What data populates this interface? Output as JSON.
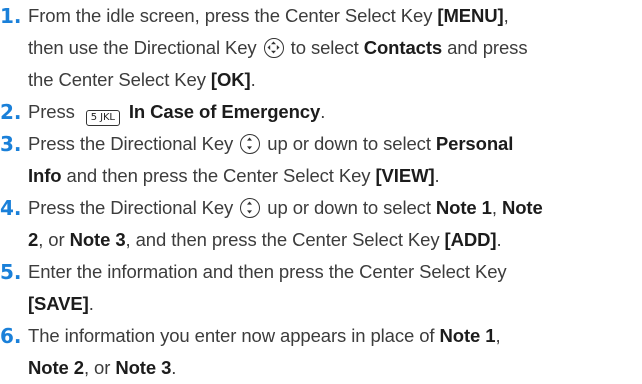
{
  "steps": [
    {
      "num": "1.",
      "l1a": "From the idle screen, press the Center Select Key ",
      "l1b": "[MENU]",
      "l1c": ",",
      "l2a": "then use the Directional Key ",
      "l2b": " to select ",
      "l2c": "Contacts",
      "l2d": " and press",
      "l3a": "the Center Select Key ",
      "l3b": "[OK]",
      "l3c": "."
    },
    {
      "num": "2.",
      "l1a": "Press ",
      "key": "5 JKL",
      "l1b": " In Case of Emergency",
      "l1c": "."
    },
    {
      "num": "3.",
      "l1a": "Press the Directional Key ",
      "l1b": " up or down to select ",
      "l1c": "Personal",
      "l2a": "Info",
      "l2b": " and then press the Center Select Key ",
      "l2c": "[VIEW]",
      "l2d": "."
    },
    {
      "num": "4.",
      "l1a": "Press the Directional Key ",
      "l1b": " up or down to select ",
      "l1c": "Note 1",
      "l1d": ", ",
      "l1e": "Note",
      "l2a": "2",
      "l2b": ", or ",
      "l2c": "Note 3",
      "l2d": ", and then press the Center Select Key ",
      "l2e": "[ADD]",
      "l2f": "."
    },
    {
      "num": "5.",
      "l1a": "Enter the information and then press the Center Select Key",
      "l2a": "[SAVE]",
      "l2b": "."
    },
    {
      "num": "6.",
      "l1a": "The information you enter now appears in place of ",
      "l1b": "Note 1",
      "l1c": ",",
      "l2a": "Note 2",
      "l2b": ", or ",
      "l2c": "Note 3",
      "l2d": "."
    }
  ],
  "icons": {
    "directional_four_way": "directional-key-icon",
    "directional_up_down": "up-down-key-icon",
    "keypad_5": "key-5-jkl-icon"
  },
  "colors": {
    "step_number": "#1a80d9",
    "text": "#3c3c3c"
  }
}
